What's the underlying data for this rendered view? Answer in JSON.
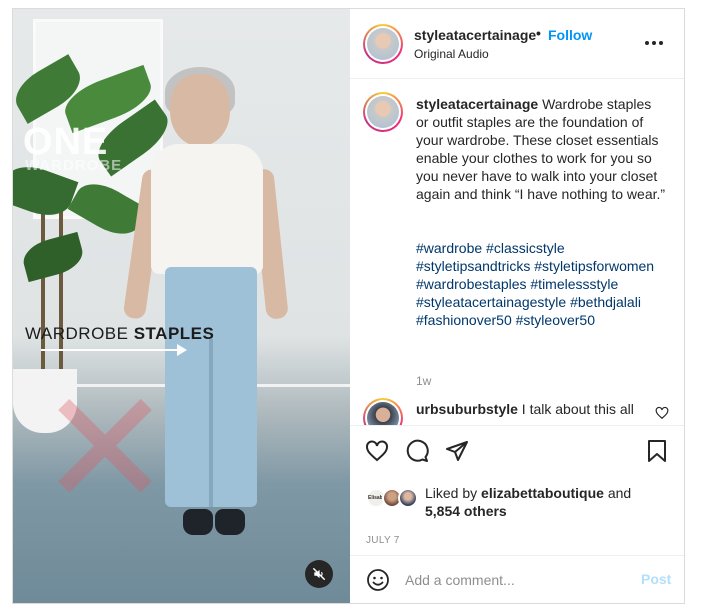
{
  "post": {
    "username": "styleatacertainage",
    "dot": "•",
    "follow_label": "Follow",
    "audio_label": "Original Audio",
    "more_icon": "more-horizontal-icon"
  },
  "media": {
    "overlay_one": "ONE",
    "overlay_wardrobe": "WARDROBE",
    "overlay_staples_light": "WARDROBE ",
    "overlay_staples_bold": "STAPLES",
    "x_mark": "✕",
    "mute_icon": "speaker-muted-icon"
  },
  "caption": {
    "username": "styleatacertainage",
    "text": " Wardrobe staples or outfit staples are the foundation of your wardrobe. These closet essentials enable your clothes to work for you so you never have to walk into your closet again and think “I have nothing to wear.”",
    "hashtags": "#wardrobe #classicstyle #styletipsandtricks #styletipsforwomen #wardrobestaples #timelessstyle #styleatacertainagestyle #bethdjalali #fashionover50 #styleover50",
    "time_ago": "1w"
  },
  "comment": {
    "username": "urbsuburbstyle",
    "text": " I talk about this all"
  },
  "actions": {
    "like_icon": "heart-icon",
    "comment_icon": "comment-icon",
    "share_icon": "share-icon",
    "save_icon": "bookmark-icon"
  },
  "likes": {
    "avatar_label": "Elisabetta",
    "prefix": "Liked by ",
    "user": "elizabettaboutique",
    "middle": " and",
    "count": "5,854 others"
  },
  "date": "JULY 7",
  "add_comment": {
    "placeholder": "Add a comment...",
    "post_label": "Post",
    "emoji_icon": "emoji-icon"
  },
  "colors": {
    "accent": "#0095f6",
    "hashtag": "#00376b",
    "muted": "#8e8e8e",
    "post_disabled": "#b2dffc"
  }
}
